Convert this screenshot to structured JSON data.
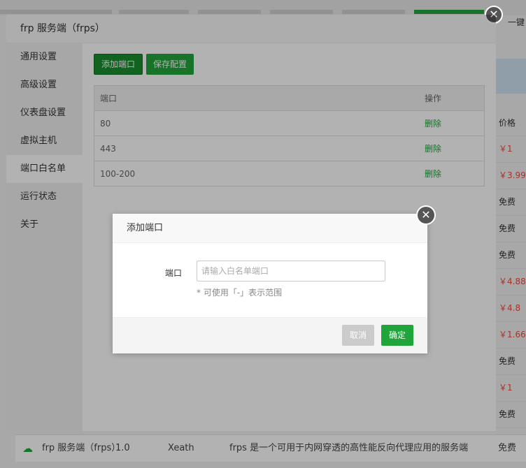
{
  "background": {
    "onekey_label": "一键",
    "price_header": "价格",
    "prices": [
      {
        "text": "￥1",
        "color": "#f0483e"
      },
      {
        "text": "￥3.99",
        "color": "#f0483e"
      },
      {
        "text": "免费",
        "color": "#333333"
      },
      {
        "text": "免费",
        "color": "#333333"
      },
      {
        "text": "免费",
        "color": "#333333"
      },
      {
        "text": "￥4.88",
        "color": "#f0483e"
      },
      {
        "text": "￥4.8",
        "color": "#f0483e"
      },
      {
        "text": "￥1.66",
        "color": "#f0483e"
      },
      {
        "text": "免费",
        "color": "#333333"
      },
      {
        "text": "￥1",
        "color": "#f0483e"
      },
      {
        "text": "免费",
        "color": "#333333"
      }
    ],
    "bottom_row": {
      "name": "frp 服务端（frps）",
      "version": "1.0",
      "author": "Xeath",
      "description": "frps 是一个可用于内网穿透的高性能反向代理应用的服务端",
      "price": "免费"
    }
  },
  "dialog": {
    "title": "frp 服务端（frps）",
    "sidebar": [
      {
        "label": "通用设置",
        "active": false
      },
      {
        "label": "高级设置",
        "active": false
      },
      {
        "label": "仪表盘设置",
        "active": false
      },
      {
        "label": "虚拟主机",
        "active": false
      },
      {
        "label": "端口白名单",
        "active": true
      },
      {
        "label": "运行状态",
        "active": false
      },
      {
        "label": "关于",
        "active": false
      }
    ],
    "toolbar": {
      "add_port": "添加端口",
      "save_config": "保存配置"
    },
    "table": {
      "col_port": "端口",
      "col_action": "操作",
      "rows": [
        {
          "port": "80",
          "action": "删除"
        },
        {
          "port": "443",
          "action": "删除"
        },
        {
          "port": "100-200",
          "action": "删除"
        }
      ]
    }
  },
  "add_port_dialog": {
    "title": "添加端口",
    "field_label": "端口",
    "placeholder": "请输入白名单端口",
    "value": "",
    "hint": "* 可使用「-」表示范围",
    "cancel": "取消",
    "confirm": "确定"
  },
  "colors": {
    "accent": "#20a53a",
    "price_red": "#f0483e"
  }
}
